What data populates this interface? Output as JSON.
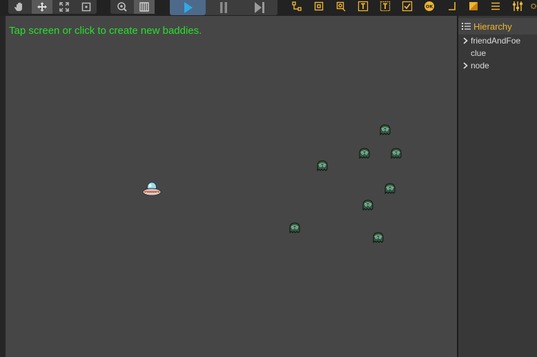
{
  "app": {
    "accent_color": "#f0b630",
    "hint_color": "#27e12b",
    "scene_background": "#464646"
  },
  "toolbar": {
    "transform_tools": [
      "hand-tool",
      "move-tool",
      "scale-tool",
      "rect-tool"
    ],
    "view_tools": [
      "zoom-tool",
      "grid-tool"
    ],
    "playback": [
      "play",
      "pause",
      "step"
    ],
    "node_tools": [
      "node-icon",
      "sprite-icon",
      "image-icon",
      "label-icon",
      "richtext-icon",
      "checkbox-icon",
      "button-icon",
      "layout-icon",
      "widget-icon",
      "list-icon",
      "slider-icon",
      "settings-icon"
    ]
  },
  "scene": {
    "hint_text": "Tap screen or click to create new baddies.",
    "player": {
      "sprite": "ufo-icon"
    },
    "baddies": {
      "sprite": "alien-octopus-icon",
      "count": 8
    }
  },
  "hierarchy": {
    "title": "Hierarchy",
    "items": [
      {
        "label": "friendAndFoe",
        "expandable": true
      },
      {
        "label": "clue",
        "expandable": false
      },
      {
        "label": "node",
        "expandable": true
      }
    ]
  }
}
